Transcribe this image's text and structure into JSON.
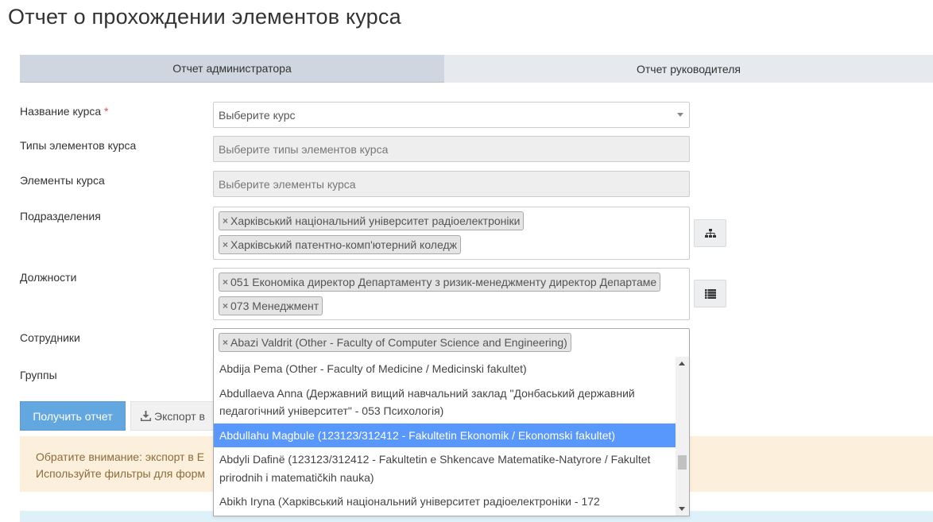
{
  "page_title": "Отчет о прохождении элементов курса",
  "tabs": [
    {
      "label": "Отчет администратора",
      "active": true
    },
    {
      "label": "Отчет руководителя",
      "active": false
    }
  ],
  "form": {
    "course_name": {
      "label": "Название курса",
      "required_mark": "*",
      "placeholder": "Выберите курс"
    },
    "element_types": {
      "label": "Типы элементов курса",
      "placeholder": "Выберите типы элементов курса"
    },
    "elements": {
      "label": "Элементы курса",
      "placeholder": "Выберите элементы курса"
    },
    "departments": {
      "label": "Подразделения",
      "chips": [
        "Харківський національний університет радіоелектроніки",
        "Харківський патентно-комп'ютерний коледж"
      ],
      "side_icon": "sitemap-icon"
    },
    "positions": {
      "label": "Должности",
      "chips": [
        "051 Економіка директор Департаменту з ризик-менеджменту директор Департаме",
        "073 Менеджмент"
      ],
      "side_icon": "list-icon"
    },
    "employees": {
      "label": "Сотрудники",
      "chips": [
        "Abazi Valdrit (Other - Faculty of Computer Science and Engineering)"
      ]
    },
    "groups": {
      "label": "Группы"
    }
  },
  "dropdown": {
    "items": [
      {
        "text": "Abdija Pema (Other - Faculty of Medicine / Medicinski fakultet)",
        "highlighted": false
      },
      {
        "text": "Abdullaeva Anna (Державний вищий навчальний заклад \"Донбаський державний педагогічний університет\" - 053 Психологія)",
        "highlighted": false
      },
      {
        "text": "Abdullahu Magbule (123123/312412 - Fakultetin Ekonomik / Ekonomski fakultet)",
        "highlighted": true
      },
      {
        "text": "Abdyli Dafinë (123123/312412 - Fakultetin e Shkencave Matematike-Natyrore / Fakultet prirodnih i matematičkih nauka)",
        "highlighted": false
      },
      {
        "text": "Abikh Iryna (Харківський національний університет радіоелектроніки - 172",
        "highlighted": false
      }
    ]
  },
  "buttons": {
    "get_report": "Получить отчет",
    "export": "Экспорт в",
    "export_icon": "download-icon"
  },
  "alert": {
    "line1": "Обратите внимание: экспорт в E",
    "line2": "Используйте фильтры для форм"
  },
  "colors": {
    "primary": "#63a7e0",
    "highlight": "#5897fb",
    "alert_bg": "#fcefdb",
    "required": "#d9534f"
  }
}
